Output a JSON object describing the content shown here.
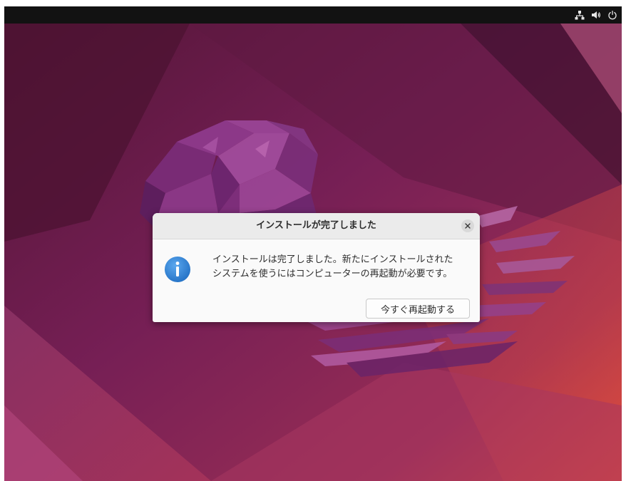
{
  "desktop": {
    "wallpaper": "ubuntu-jammy-jellyfish-wallpaper"
  },
  "top_bar": {
    "tray_icons": [
      "network-icon",
      "volume-icon",
      "power-icon"
    ]
  },
  "dialog": {
    "title": "インストールが完了しました",
    "message_lines": [
      "インストールは完了しました。新たにインストールされた",
      "システムを使うにはコンピューターの再起動が必要です。"
    ],
    "icon": "info-icon",
    "restart_button_label": "今すぐ再起動する",
    "close_icon": "close-icon"
  },
  "colors": {
    "top_bar": "#121212",
    "dialog_background": "#fafafa",
    "dialog_header": "#ebebeb",
    "info_icon_blue": "#2f85d8"
  }
}
